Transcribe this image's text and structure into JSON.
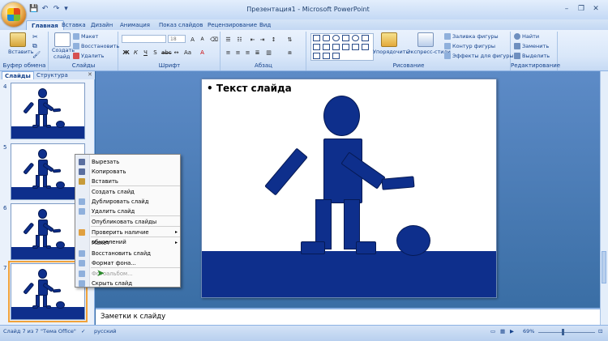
{
  "window": {
    "title": "Презентация1 - Microsoft PowerPoint"
  },
  "tabs": [
    "Главная",
    "Вставка",
    "Дизайн",
    "Анимация",
    "Показ слайдов",
    "Рецензирование",
    "Вид"
  ],
  "ribbon": {
    "clipboard": {
      "paste": "Вставить",
      "label": "Буфер обмена"
    },
    "slides": {
      "create": "Создать",
      "slide": "слайд",
      "layout": "Макет",
      "reset": "Восстановить",
      "delete": "Удалить",
      "label": "Слайды"
    },
    "font": {
      "size": "18",
      "label": "Шрифт"
    },
    "paragraph": {
      "label": "Абзац"
    },
    "drawing": {
      "arrange": "Упорядочить",
      "quick_styles": "Экспресс-стили",
      "fill": "Заливка фигуры",
      "outline": "Контур фигуры",
      "effects": "Эффекты для фигуры",
      "label": "Рисование"
    },
    "editing": {
      "find": "Найти",
      "replace": "Заменить",
      "select": "Выделить",
      "label": "Редактирование"
    }
  },
  "left_panel": {
    "tabs": [
      "Слайды",
      "Структура"
    ],
    "thumbs": [
      {
        "num": "4"
      },
      {
        "num": "5"
      },
      {
        "num": "6"
      },
      {
        "num": "7"
      }
    ]
  },
  "slide": {
    "bullet": "•",
    "text": "Текст слайда"
  },
  "notes": {
    "placeholder": "Заметки к слайду"
  },
  "context_menu": {
    "items": [
      {
        "label": "Вырезать",
        "disabled": false
      },
      {
        "label": "Копировать",
        "disabled": false
      },
      {
        "label": "Вставить",
        "disabled": false
      },
      {
        "label": "Создать слайд",
        "disabled": false
      },
      {
        "label": "Дублировать слайд",
        "disabled": false
      },
      {
        "label": "Удалить слайд",
        "disabled": false
      },
      {
        "label": "Опубликовать слайды",
        "disabled": false
      },
      {
        "label": "Проверить наличие обновлений",
        "disabled": false,
        "submenu": true
      },
      {
        "label": "Макет",
        "disabled": false,
        "submenu": true
      },
      {
        "label": "Восстановить слайд",
        "disabled": false
      },
      {
        "label": "Формат фона...",
        "disabled": false
      },
      {
        "label": "Фотоальбом...",
        "disabled": true
      },
      {
        "label": "Скрыть слайд",
        "disabled": false
      }
    ]
  },
  "status": {
    "slide_count": "Слайд 7 из 7",
    "theme": "\"Тема Office\"",
    "language": "русский",
    "zoom": "69%"
  },
  "colors": {
    "figure": "#0e2f8c",
    "accent": "#15428b"
  }
}
